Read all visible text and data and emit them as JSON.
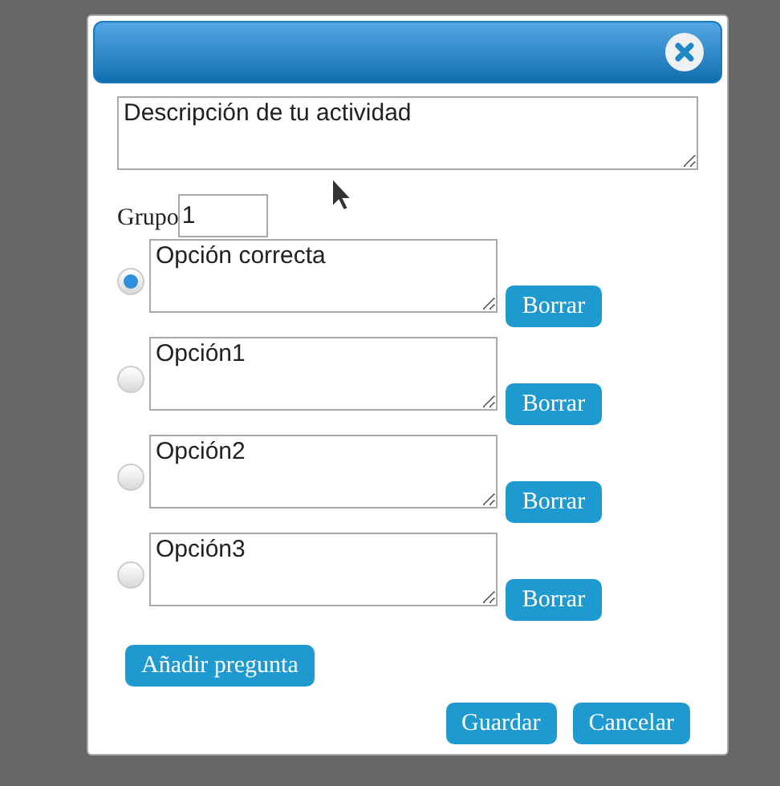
{
  "dialog": {
    "description": {
      "value": "Descripción de tu actividad"
    },
    "group": {
      "label": "Grupo",
      "value": "1"
    },
    "options": [
      {
        "value": "Opción correcta",
        "selected": true,
        "delete_label": "Borrar"
      },
      {
        "value": "Opción1",
        "selected": false,
        "delete_label": "Borrar"
      },
      {
        "value": "Opción2",
        "selected": false,
        "delete_label": "Borrar"
      },
      {
        "value": "Opción3",
        "selected": false,
        "delete_label": "Borrar"
      }
    ],
    "add_question_label": "Añadir pregunta",
    "buttons": [
      "Guardar",
      "Cancelar"
    ]
  }
}
